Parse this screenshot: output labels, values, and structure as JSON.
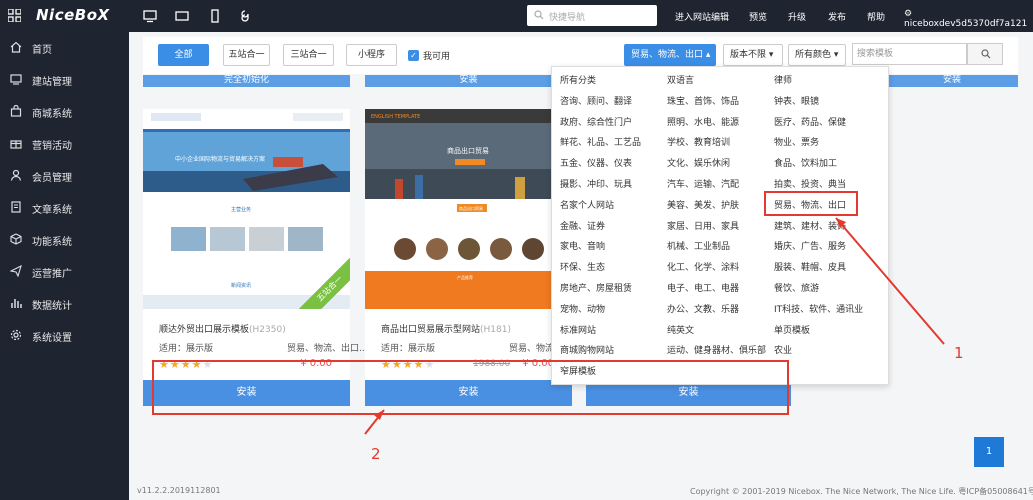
{
  "topbar": {
    "logo": "NiceBoX",
    "search_placeholder": "快捷导航",
    "nav": [
      "进入网站编辑",
      "预览",
      "升级",
      "发布",
      "帮助"
    ],
    "user": "niceboxdev5d5370df7a121"
  },
  "sidebar": {
    "items": [
      {
        "label": "首页",
        "icon": "home-icon"
      },
      {
        "label": "建站管理",
        "icon": "site-icon"
      },
      {
        "label": "商城系统",
        "icon": "shop-icon"
      },
      {
        "label": "营销活动",
        "icon": "gift-icon"
      },
      {
        "label": "会员管理",
        "icon": "user-icon"
      },
      {
        "label": "文章系统",
        "icon": "article-icon"
      },
      {
        "label": "功能系统",
        "icon": "cube-icon"
      },
      {
        "label": "运营推广",
        "icon": "send-icon"
      },
      {
        "label": "数据统计",
        "icon": "chart-icon"
      },
      {
        "label": "系统设置",
        "icon": "gear-icon"
      }
    ]
  },
  "filters": {
    "buttons": [
      "全部",
      "五站合一",
      "三站合一",
      "小程序"
    ],
    "checkbox_label": "我可用",
    "dropdowns": [
      "贸易、物流、出口",
      "版本不限",
      "所有颜色"
    ],
    "search_placeholder": "搜索模板"
  },
  "strips": [
    "完全初始化",
    "安装",
    "安装"
  ],
  "cards": [
    {
      "name": "顺达外贸出口展示模板",
      "code": "(H2350)",
      "apply": "适用：展示版",
      "tags": "贸易、物流、出口...",
      "price": "¥ 0.00",
      "old_price": "",
      "install": "安装",
      "ribbon": "五站合一"
    },
    {
      "name": "商品出口贸易展示型网站",
      "code": "(H181)",
      "apply": "适用：展示版",
      "tags": "贸易、物流、出口...",
      "price": "¥ 0.00",
      "old_price": "1988.00",
      "install": "安装",
      "ribbon": ""
    },
    {
      "install": "安装"
    }
  ],
  "thumb_text": {
    "card1_hero": "中小企业国际物流与贸易解决方案",
    "card1_section": "主营业务",
    "card1_news": "新闻资讯",
    "card2_brand": "ENGLISH TEMPLATE",
    "card2_hero": "商品出口贸易",
    "card2_bar": "商品出口贸易",
    "card2_sub": "产品推荐"
  },
  "dropdown": {
    "col1": [
      "所有分类",
      "咨询、顾问、翻译",
      "政府、综合性门户",
      "鲜花、礼品、工艺品",
      "五金、仪器、仪表",
      "摄影、冲印、玩具",
      "名家个人网站",
      "金融、证券",
      "家电、音响",
      "环保、生态",
      "房地产、房屋租赁",
      "宠物、动物",
      "标准网站",
      "商城购物网站",
      "窄屏模板"
    ],
    "col2": [
      "双语言",
      "珠宝、首饰、饰品",
      "照明、水电、能源",
      "学校、教育培训",
      "文化、娱乐休闲",
      "汽车、运输、汽配",
      "美容、美发、护肤",
      "家居、日用、家具",
      "机械、工业制品",
      "化工、化学、涂料",
      "电子、电工、电器",
      "办公、文教、乐器",
      "纯英文",
      "运动、健身器材、俱乐部"
    ],
    "col3": [
      "律师",
      "钟表、眼镜",
      "医疗、药品、保健",
      "物业、票务",
      "食品、饮料加工",
      "拍卖、投资、典当",
      "贸易、物流、出口",
      "建筑、建材、装饰",
      "婚庆、广告、服务",
      "服装、鞋帽、皮具",
      "餐饮、旅游",
      "IT科技、软件、通讯业",
      "单页模板",
      "农业"
    ]
  },
  "annotations": {
    "label1": "1",
    "label2": "2"
  },
  "colors": {
    "accent": "#3a8ee6",
    "dark": "#1f2431",
    "annotation": "#e23a2e",
    "ribbon": "#7ac143"
  },
  "pagination": {
    "current": "1"
  },
  "footer": {
    "version": "v11.2.2.2019112801",
    "copyright": "Copyright © 2001-2019 Nicebox. The Nice Network, The Nice Life.",
    "icp": "粤ICP备05008641号"
  }
}
